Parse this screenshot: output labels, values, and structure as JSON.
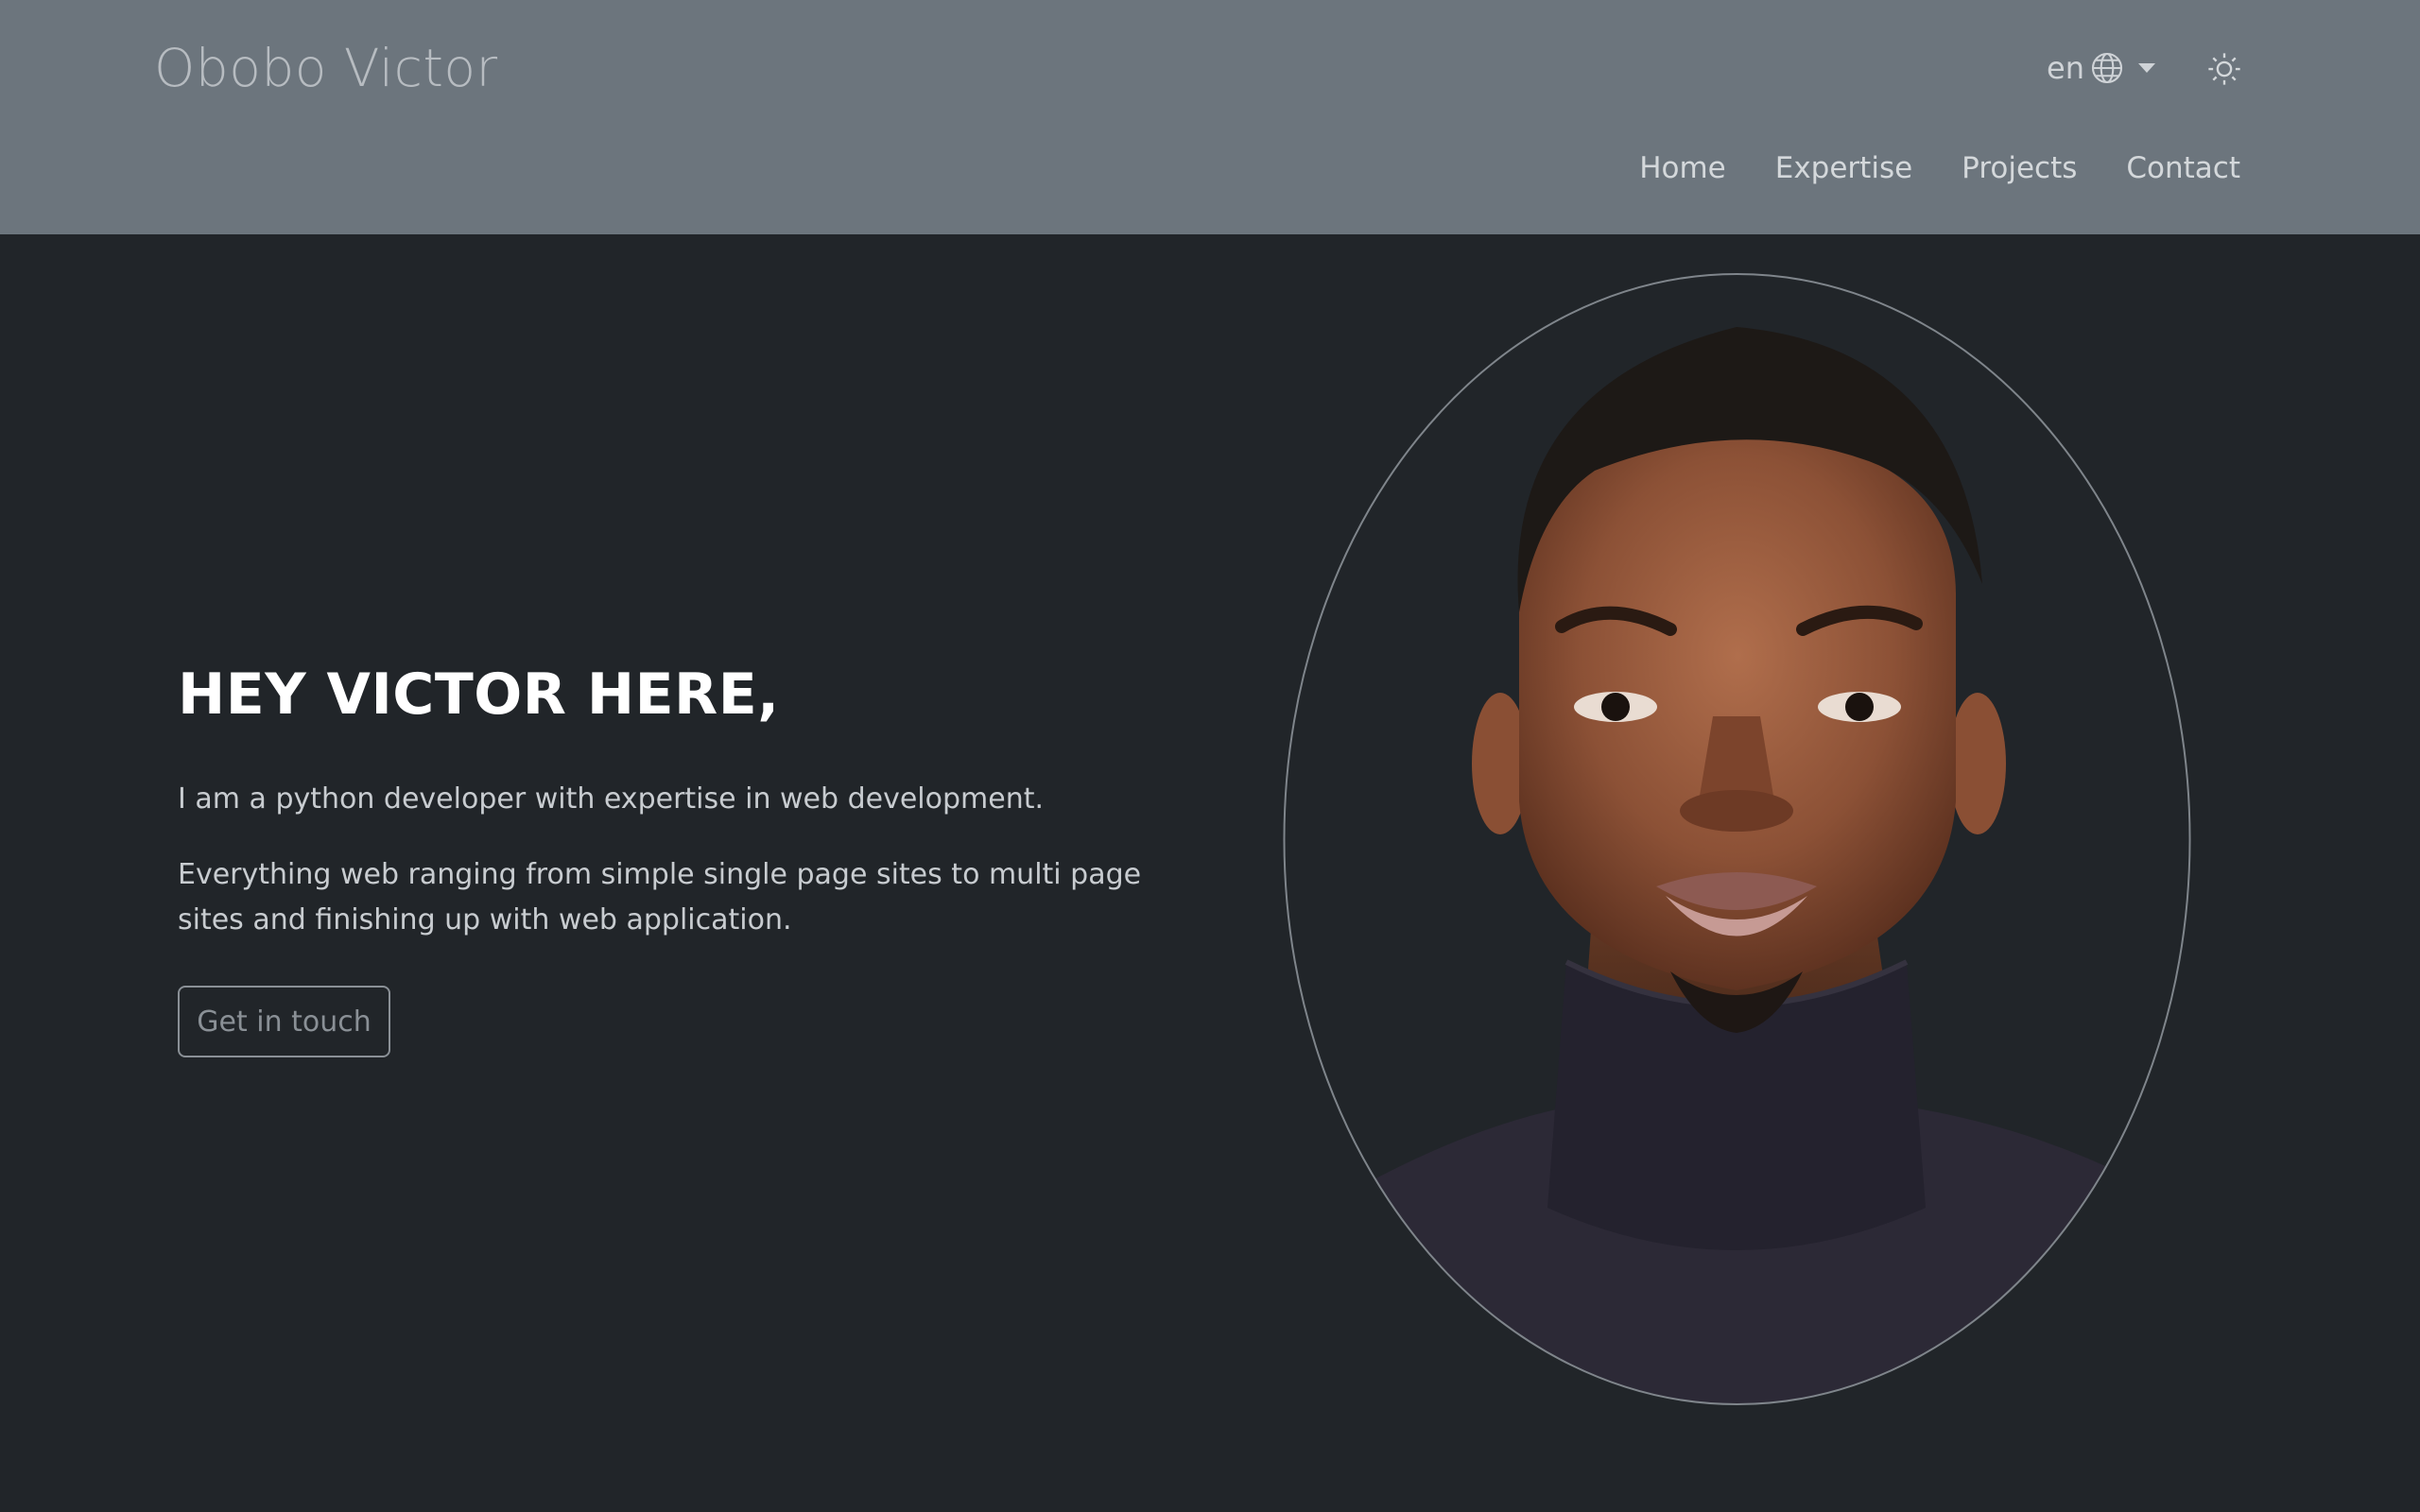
{
  "header": {
    "brand": "Obobo Victor",
    "language": {
      "code": "en",
      "icon": "globe-icon"
    },
    "theme_toggle_icon": "sun-icon",
    "nav": [
      "Home",
      "Expertise",
      "Projects",
      "Contact"
    ]
  },
  "hero": {
    "title": "HEY VICTOR HERE,",
    "intro": "I am a python developer with expertise in web development.",
    "description": "Everything web ranging from simple single page sites to multi page sites and finishing up with web application.",
    "cta_label": "Get in touch"
  },
  "colors": {
    "header_bg": "#6c757d",
    "page_bg": "#212529",
    "title": "#ffffff",
    "body_text": "#c8ccd0",
    "outline": "#8a9096"
  }
}
